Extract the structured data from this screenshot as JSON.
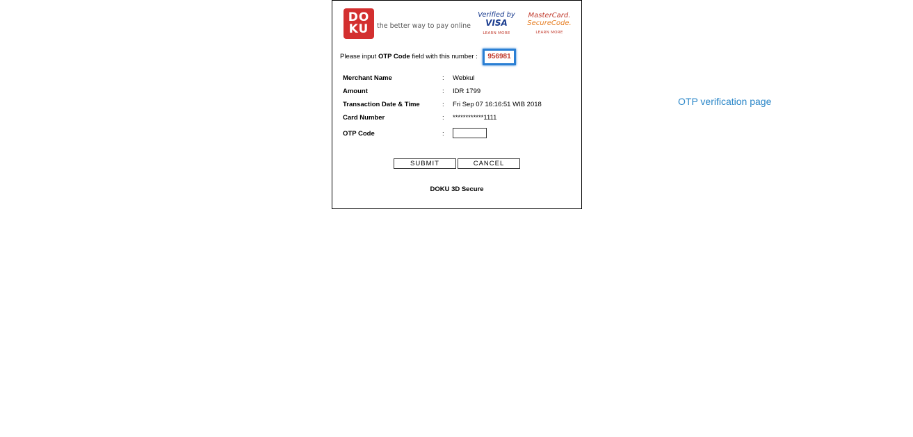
{
  "header": {
    "logo_line1": "DO",
    "logo_line2": "KU",
    "tagline": "the better way to pay online",
    "visa": {
      "top": "Verified by",
      "main": "VISA",
      "learn_more": "LEARN MORE"
    },
    "mastercard": {
      "top": "MasterCard.",
      "bottom": "SecureCode.",
      "learn_more": "LEARN MORE"
    }
  },
  "instruction": {
    "prefix": "Please input ",
    "bold": "OTP Code",
    "suffix": " field with this number : ",
    "otp_number": "956981"
  },
  "details": {
    "colon": ":",
    "merchant_label": "Merchant Name",
    "merchant_value": "Webkul",
    "amount_label": "Amount",
    "amount_value": "IDR 1799",
    "datetime_label": "Transaction Date & Time",
    "datetime_value": "Fri Sep 07 16:16:51 WIB 2018",
    "card_label": "Card Number",
    "card_value": "************1111",
    "otp_label": "OTP Code",
    "otp_value": ""
  },
  "buttons": {
    "submit": "SUBMIT",
    "cancel": "CANCEL"
  },
  "footer": {
    "label": "DOKU 3D Secure"
  },
  "caption": "OTP verification page",
  "colors": {
    "doku_red": "#d32f2f",
    "highlight_blue": "#2a7fd4",
    "otp_number_red": "#c0392b",
    "caption_blue": "#2a86c8"
  }
}
